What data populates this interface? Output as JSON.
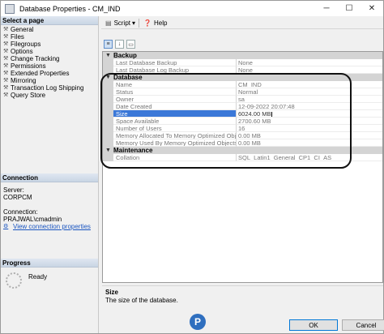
{
  "window": {
    "title": "Database Properties - CM_IND",
    "minimize": "─",
    "maximize": "☐",
    "close": "✕"
  },
  "left": {
    "select_page_heading": "Select a page",
    "pages": [
      "General",
      "Files",
      "Filegroups",
      "Options",
      "Change Tracking",
      "Permissions",
      "Extended Properties",
      "Mirroring",
      "Transaction Log Shipping",
      "Query Store"
    ],
    "connection_heading": "Connection",
    "server_label": "Server:",
    "server_value": "CORPCM",
    "connection_label": "Connection:",
    "connection_value": "PRAJWAL\\cmadmin",
    "view_connection_link": "View connection properties",
    "progress_heading": "Progress",
    "progress_status": "Ready"
  },
  "toolbar": {
    "script_label": "Script",
    "help_label": "Help",
    "script_dropdown": "▾"
  },
  "grid": {
    "categories": [
      {
        "name": "Backup",
        "toggle": "▼",
        "rows": [
          {
            "name": "Last Database Backup",
            "value": "None"
          },
          {
            "name": "Last Database Log Backup",
            "value": "None"
          }
        ]
      },
      {
        "name": "Database",
        "toggle": "▼",
        "rows": [
          {
            "name": "Name",
            "value": "CM_IND"
          },
          {
            "name": "Status",
            "value": "Normal"
          },
          {
            "name": "Owner",
            "value": "sa"
          },
          {
            "name": "Date Created",
            "value": "12-09-2022 20:07:48"
          },
          {
            "name": "Size",
            "value": "6024.00 MB"
          },
          {
            "name": "Space Available",
            "value": "2700.60 MB"
          },
          {
            "name": "Number of Users",
            "value": "16"
          },
          {
            "name": "Memory Allocated To Memory Optimized Objects",
            "value": "0.00 MB"
          },
          {
            "name": "Memory Used By Memory Optimized Objects",
            "value": "0.00 MB"
          }
        ]
      },
      {
        "name": "Maintenance",
        "toggle": "▼",
        "rows": [
          {
            "name": "Collation",
            "value": "SQL_Latin1_General_CP1_CI_AS"
          }
        ]
      }
    ]
  },
  "description": {
    "title": "Size",
    "text": "The size of the database."
  },
  "buttons": {
    "ok": "OK",
    "cancel": "Cancel"
  },
  "logo": {
    "text": "P"
  }
}
